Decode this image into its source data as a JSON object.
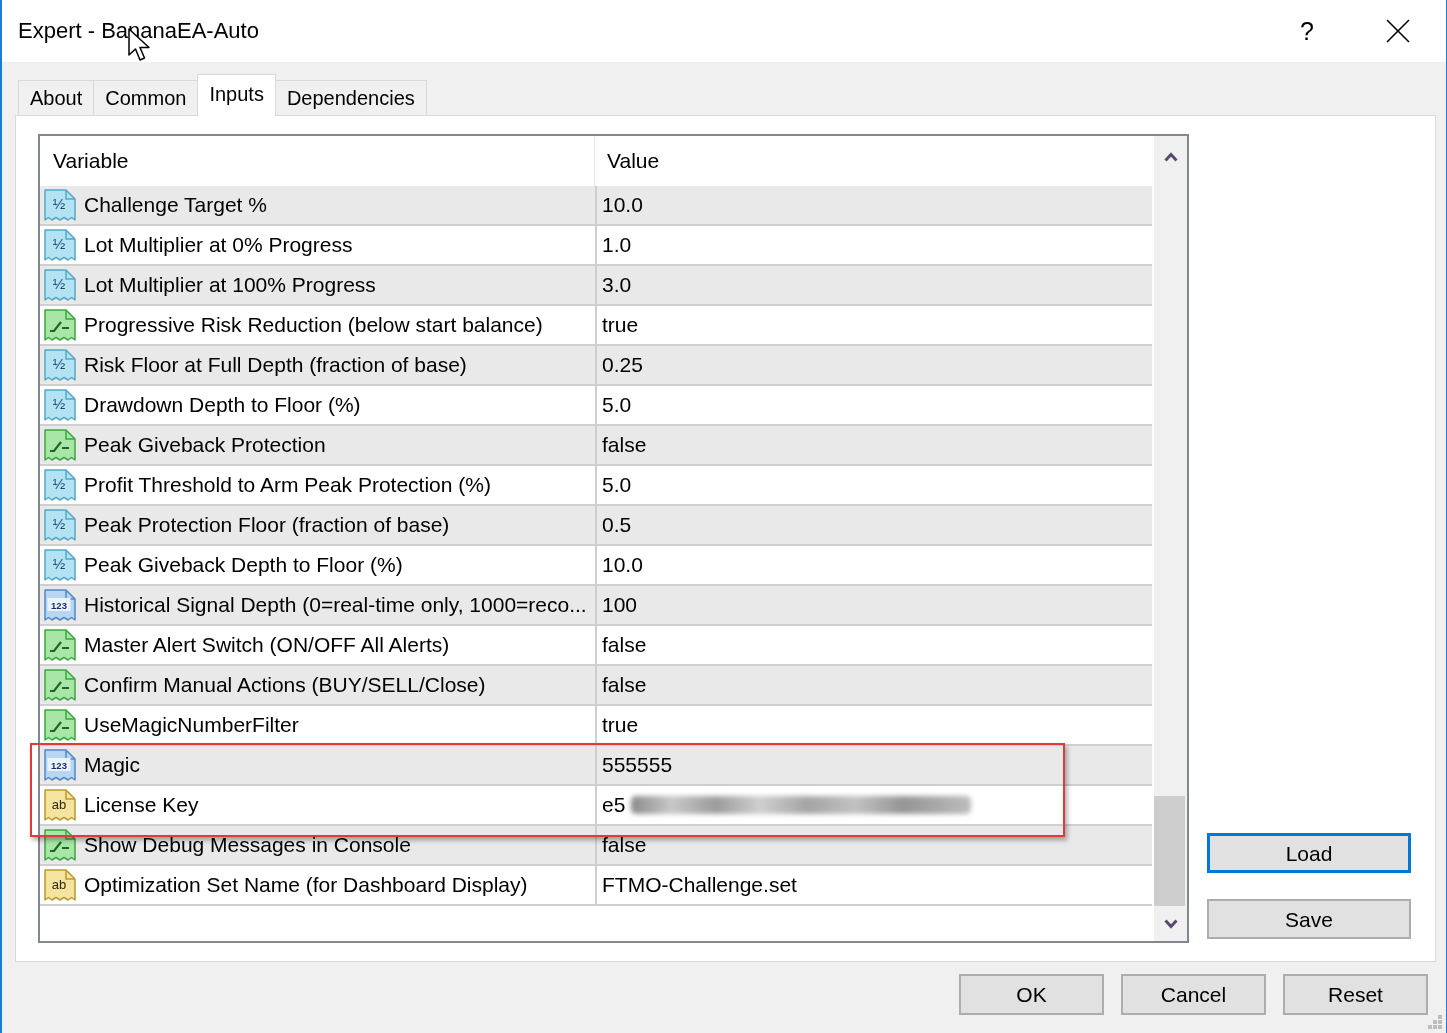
{
  "window": {
    "title": "Expert - BananaEA-Auto",
    "help_button": "?"
  },
  "tabs": [
    {
      "label": "About",
      "selected": false
    },
    {
      "label": "Common",
      "selected": false
    },
    {
      "label": "Inputs",
      "selected": true
    },
    {
      "label": "Dependencies",
      "selected": false
    }
  ],
  "inputs_table": {
    "columns": [
      "Variable",
      "Value"
    ],
    "rows": [
      {
        "kind": "double",
        "icon_text": "½",
        "variable": "Challenge Target %",
        "value": "10.0",
        "highlighted": false,
        "redacted": false
      },
      {
        "kind": "double",
        "icon_text": "½",
        "variable": "Lot Multiplier at 0% Progress",
        "value": "1.0",
        "highlighted": false,
        "redacted": false
      },
      {
        "kind": "double",
        "icon_text": "½",
        "variable": "Lot Multiplier at 100% Progress",
        "value": "3.0",
        "highlighted": false,
        "redacted": false
      },
      {
        "kind": "bool",
        "variable": "Progressive Risk Reduction (below start balance)",
        "value": "true",
        "highlighted": false,
        "redacted": false
      },
      {
        "kind": "double",
        "icon_text": "½",
        "variable": "Risk Floor at Full Depth (fraction of base)",
        "value": "0.25",
        "highlighted": false,
        "redacted": false
      },
      {
        "kind": "double",
        "icon_text": "½",
        "variable": "Drawdown Depth to Floor (%)",
        "value": "5.0",
        "highlighted": false,
        "redacted": false
      },
      {
        "kind": "bool",
        "variable": "Peak Giveback Protection",
        "value": "false",
        "highlighted": false,
        "redacted": false
      },
      {
        "kind": "double",
        "icon_text": "½",
        "variable": "Profit Threshold to Arm Peak Protection (%)",
        "value": "5.0",
        "highlighted": false,
        "redacted": false
      },
      {
        "kind": "double",
        "icon_text": "½",
        "variable": "Peak Protection Floor (fraction of base)",
        "value": "0.5",
        "highlighted": false,
        "redacted": false
      },
      {
        "kind": "double",
        "icon_text": "½",
        "variable": "Peak Giveback Depth to Floor (%)",
        "value": "10.0",
        "highlighted": false,
        "redacted": false
      },
      {
        "kind": "int",
        "icon_text": "123",
        "variable": "Historical Signal Depth (0=real-time only, 1000=reco...",
        "value": "100",
        "highlighted": false,
        "redacted": false
      },
      {
        "kind": "bool",
        "variable": "Master Alert Switch (ON/OFF All Alerts)",
        "value": "false",
        "highlighted": false,
        "redacted": false
      },
      {
        "kind": "bool",
        "variable": "Confirm Manual Actions (BUY/SELL/Close)",
        "value": "false",
        "highlighted": false,
        "redacted": false
      },
      {
        "kind": "bool",
        "variable": "UseMagicNumberFilter",
        "value": "true",
        "highlighted": false,
        "redacted": false
      },
      {
        "kind": "int",
        "icon_text": "123",
        "variable": "Magic",
        "value": "555555",
        "highlighted": true,
        "redacted": false
      },
      {
        "kind": "string",
        "icon_text": "ab",
        "variable": "License Key",
        "value": "e5",
        "highlighted": true,
        "redacted": true
      },
      {
        "kind": "bool",
        "variable": "Show Debug Messages in Console",
        "value": "false",
        "highlighted": false,
        "redacted": false
      },
      {
        "kind": "string",
        "icon_text": "ab",
        "variable": "Optimization Set Name (for Dashboard Display)",
        "value": "FTMO-Challenge.set",
        "highlighted": false,
        "redacted": false
      }
    ]
  },
  "side_buttons": [
    {
      "label": "Load",
      "default": true
    },
    {
      "label": "Save",
      "default": false
    }
  ],
  "footer_buttons": [
    "OK",
    "Cancel",
    "Reset"
  ]
}
